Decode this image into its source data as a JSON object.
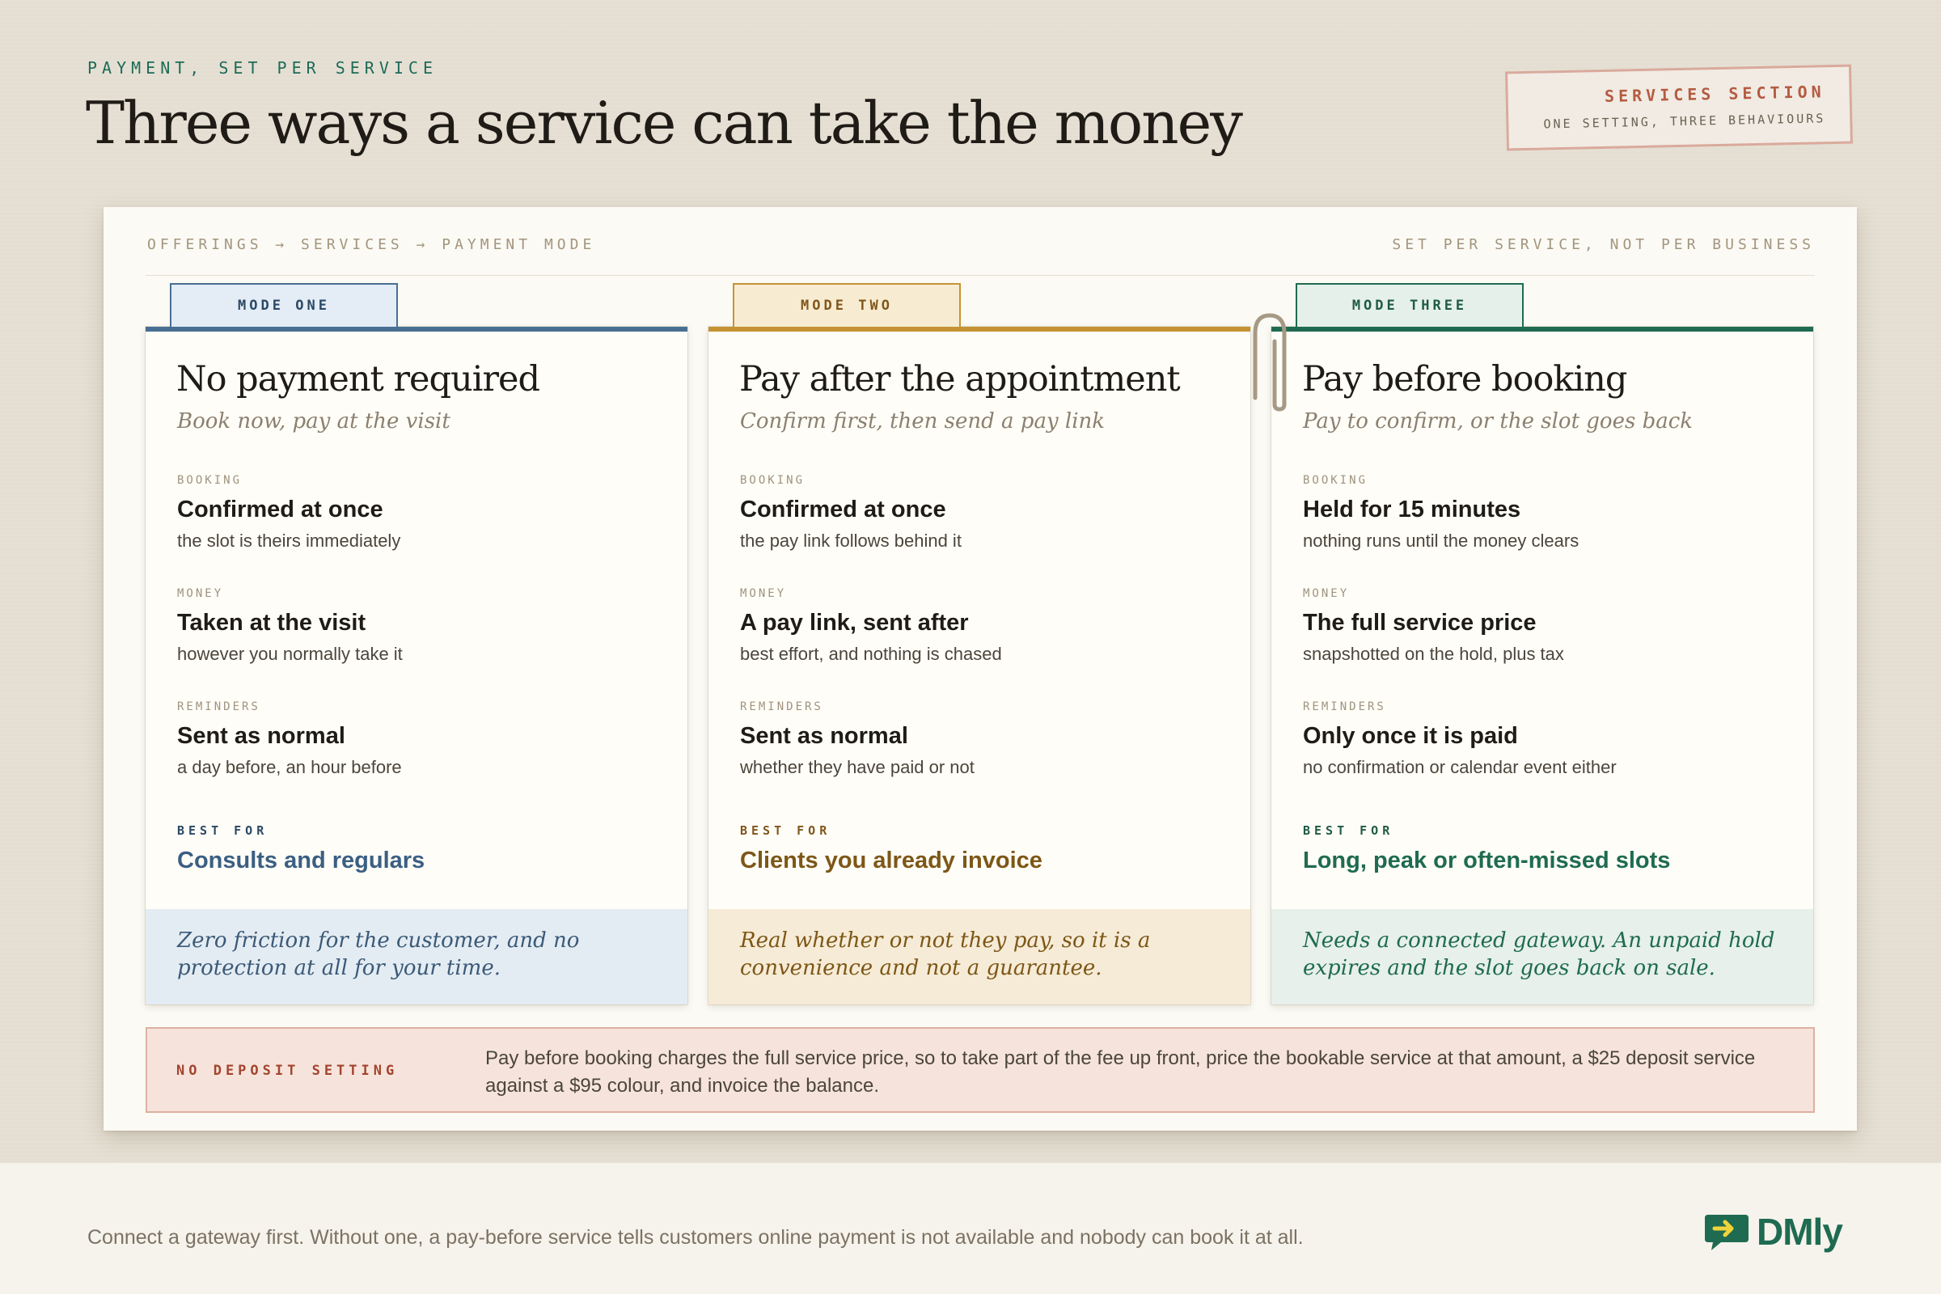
{
  "header": {
    "eyebrow": "PAYMENT, SET PER SERVICE",
    "title": "Three ways a service can take the money"
  },
  "stamp": {
    "title": "SERVICES SECTION",
    "subtitle": "ONE SETTING, THREE BEHAVIOURS"
  },
  "panel": {
    "breadcrumb": "OFFERINGS → SERVICES → PAYMENT MODE",
    "scope_note": "SET PER SERVICE, NOT PER BUSINESS"
  },
  "labels": {
    "booking": "BOOKING",
    "money": "MONEY",
    "reminders": "REMINDERS",
    "best_for": "BEST FOR"
  },
  "modes": [
    {
      "tab": "MODE ONE",
      "title": "No payment required",
      "subtitle": "Book now, pay at the visit",
      "booking": {
        "value": "Confirmed at once",
        "note": "the slot is theirs immediately"
      },
      "money": {
        "value": "Taken at the visit",
        "note": "however you normally take it"
      },
      "reminders": {
        "value": "Sent as normal",
        "note": "a day before, an hour before"
      },
      "best_for": "Consults and regulars",
      "footer": "Zero friction for the customer, and no protection at all for your time.",
      "accent": "#486f93"
    },
    {
      "tab": "MODE TWO",
      "title": "Pay after the appointment",
      "subtitle": "Confirm first, then send a pay link",
      "booking": {
        "value": "Confirmed at once",
        "note": "the pay link follows behind it"
      },
      "money": {
        "value": "A pay link, sent after",
        "note": "best effort, and nothing is chased"
      },
      "reminders": {
        "value": "Sent as normal",
        "note": "whether they have paid or not"
      },
      "best_for": "Clients you already invoice",
      "footer": "Real whether or not they pay, so it is a convenience and not a guarantee.",
      "accent": "#c59334"
    },
    {
      "tab": "MODE THREE",
      "title": "Pay before booking",
      "subtitle": "Pay to confirm, or the slot goes back",
      "booking": {
        "value": "Held for 15 minutes",
        "note": "nothing runs until the money clears"
      },
      "money": {
        "value": "The full service price",
        "note": "snapshotted on the hold, plus tax"
      },
      "reminders": {
        "value": "Only once it is paid",
        "note": "no confirmation or calendar event either"
      },
      "best_for": "Long, peak or often-missed slots",
      "footer": "Needs a connected gateway. An unpaid hold expires and the slot goes back on sale.",
      "accent": "#1f6b52"
    }
  ],
  "deposit": {
    "label": "NO DEPOSIT SETTING",
    "text": "Pay before booking charges the full service price, so to take part of the fee up front, price the bookable service at that amount, a $25 deposit service against a $95 colour, and invoice the balance."
  },
  "footer": {
    "text": "Connect a gateway first. Without one, a pay-before service tells customers online payment is not available and nobody can book it at all.",
    "logo_text": "DMly",
    "logo_icon": "arrow-chat-icon"
  }
}
